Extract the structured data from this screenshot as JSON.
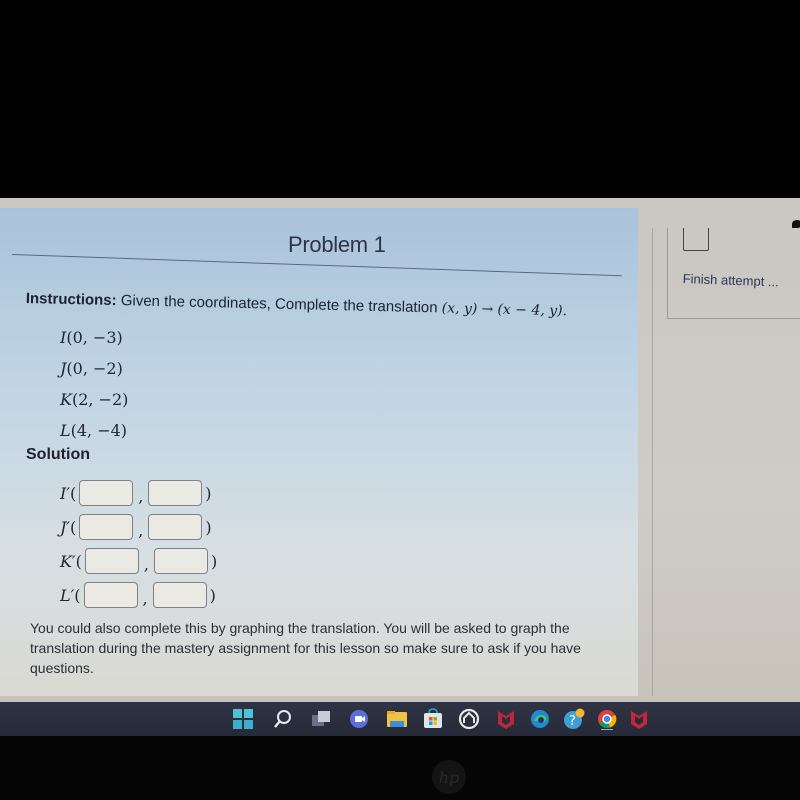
{
  "problem": {
    "title": "Problem 1",
    "instructions_label": "Instructions:",
    "instructions_text": "Given the coordinates, Complete the translation",
    "rule_from": "(x, y)",
    "rule_arrow": "→",
    "rule_to": "(x − 4, y).",
    "given_points": [
      {
        "name": "I",
        "coords": "(0, −3)"
      },
      {
        "name": "J",
        "coords": "(0, −2)"
      },
      {
        "name": "K",
        "coords": "(2, −2)"
      },
      {
        "name": "L",
        "coords": "(4, −4)"
      }
    ],
    "solution_label": "Solution",
    "answers": [
      {
        "name": "I′",
        "x_value": "",
        "y_value": ""
      },
      {
        "name": "J′",
        "x_value": "",
        "y_value": ""
      },
      {
        "name": "K′",
        "x_value": "",
        "y_value": ""
      },
      {
        "name": "L′",
        "x_value": "",
        "y_value": ""
      }
    ],
    "open_paren": "(",
    "comma": ",",
    "close_paren": ")",
    "note": "You could also complete this by graphing the translation. You will be asked to graph the translation during the mastery assignment for this lesson so make sure to ask if you have questions."
  },
  "sidebar": {
    "finish_attempt_label": "Finish attempt ..."
  },
  "taskbar": {
    "icons": [
      "windows-start-icon",
      "search-icon",
      "task-view-icon",
      "chat-video-icon",
      "file-explorer-icon",
      "microsoft-store-icon",
      "dell-support-icon",
      "mcafee-icon",
      "edge-icon",
      "help-app-icon",
      "chrome-icon",
      "mcafee-security-icon"
    ]
  },
  "device": {
    "brand": "hp"
  }
}
